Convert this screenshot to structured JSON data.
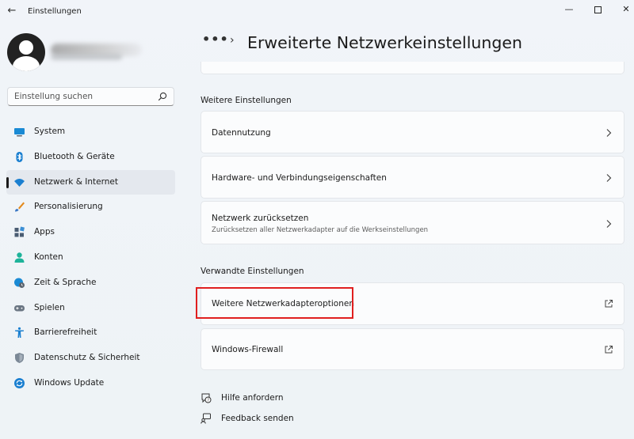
{
  "window": {
    "app_title": "Einstellungen",
    "back": "←",
    "minimize": "—",
    "close": "✕"
  },
  "search": {
    "placeholder": "Einstellung suchen"
  },
  "sidebar": {
    "items": [
      {
        "label": "System",
        "icon": "system-icon",
        "color": "#1a8ad4"
      },
      {
        "label": "Bluetooth & Geräte",
        "icon": "bluetooth-icon",
        "color": "#1a7fd0"
      },
      {
        "label": "Netzwerk & Internet",
        "icon": "wifi-icon",
        "color": "#1a7fd0",
        "active": true
      },
      {
        "label": "Personalisierung",
        "icon": "brush-icon",
        "color": "#e38a1d"
      },
      {
        "label": "Apps",
        "icon": "apps-icon",
        "color": "#4a5c72"
      },
      {
        "label": "Konten",
        "icon": "account-icon",
        "color": "#1eb39a"
      },
      {
        "label": "Zeit & Sprache",
        "icon": "globe-clock-icon",
        "color": "#1a8ad4"
      },
      {
        "label": "Spielen",
        "icon": "gamepad-icon",
        "color": "#6b7683"
      },
      {
        "label": "Barrierefreiheit",
        "icon": "accessibility-icon",
        "color": "#1a7fd0"
      },
      {
        "label": "Datenschutz & Sicherheit",
        "icon": "shield-icon",
        "color": "#7b8896"
      },
      {
        "label": "Windows Update",
        "icon": "update-icon",
        "color": "#1a7fd0"
      }
    ]
  },
  "header": {
    "breadcrumb_more": "•••",
    "breadcrumb_sep": "›",
    "title": "Erweiterte Netzwerkeinstellungen"
  },
  "sections": {
    "more_settings": {
      "title": "Weitere Einstellungen",
      "items": [
        {
          "title": "Datennutzung"
        },
        {
          "title": "Hardware- und Verbindungseigenschaften"
        },
        {
          "title": "Netzwerk zurücksetzen",
          "subtitle": "Zurücksetzen aller Netzwerkadapter auf die Werkseinstellungen"
        }
      ]
    },
    "related_settings": {
      "title": "Verwandte Einstellungen",
      "items": [
        {
          "title": "Weitere Netzwerkadapteroptionen"
        },
        {
          "title": "Windows-Firewall"
        }
      ]
    }
  },
  "help": {
    "get_help": "Hilfe anfordern",
    "feedback": "Feedback senden"
  },
  "colors": {
    "accent": "#1a7fd0",
    "highlight_box": "#e01f1f"
  }
}
